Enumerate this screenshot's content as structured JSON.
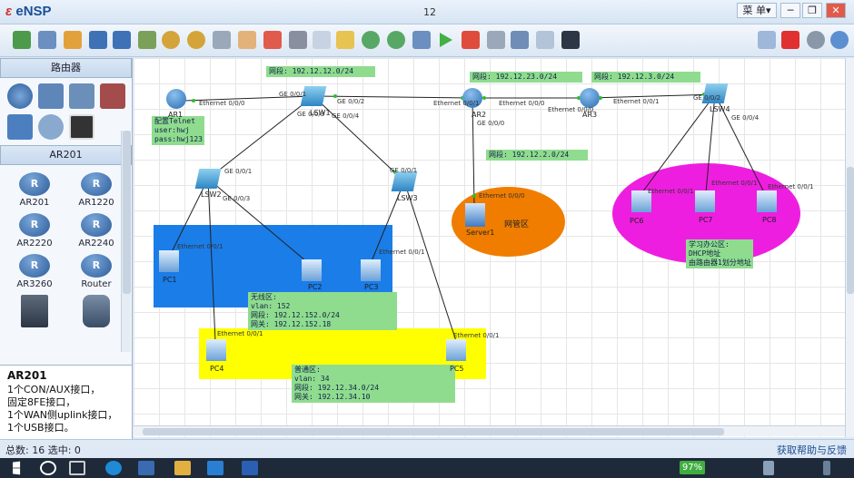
{
  "window": {
    "app_name": "eNSP",
    "title": "12",
    "menu_label": "菜 单▾",
    "min_label": "─",
    "max_label": "❐",
    "close_label": "✕"
  },
  "toolbar": {
    "buttons": [
      "new-topology-icon",
      "new-example-icon",
      "open-icon",
      "save-icon",
      "save-as-icon",
      "print-icon",
      "undo-icon",
      "redo-icon",
      "select-icon",
      "pan-hand-icon",
      "delete-icon",
      "delete-all-connections-icon",
      "text-icon",
      "palette-icon",
      "zoom-in-icon",
      "zoom-out-icon",
      "fit-view-icon",
      "start-icon",
      "stop-icon",
      "capture-icon",
      "topology-icon",
      "console-icon",
      "screenshot-icon"
    ],
    "right_buttons": [
      "chat-icon",
      "huawei-icon",
      "settings-icon",
      "help-icon"
    ]
  },
  "palette": {
    "section_routers": "路由器",
    "section_ar201": "AR201",
    "devices": [
      {
        "label": "AR201"
      },
      {
        "label": "AR1220"
      },
      {
        "label": "AR2220"
      },
      {
        "label": "AR2240"
      },
      {
        "label": "AR3260"
      },
      {
        "label": "Router"
      }
    ],
    "description_title": "AR201",
    "description_lines": [
      "1个CON/AUX接口，",
      "固定8FE接口，",
      "1个WAN侧uplink接口，",
      "1个USB接口。"
    ]
  },
  "canvas": {
    "notes": {
      "net_12_12": "网段: 192.12.12.0/24",
      "net_12_23": "网段: 192.12.23.0/24",
      "net_12_3": "网段: 192.12.3.0/24",
      "net_12_2": "网段: 192.12.2.0/24",
      "telnet": "配置Telnet\nuser:hwj\npass:hwj123",
      "wireless": "无线区:\nvlan: 152\n网段: 192.12.152.0/24\n网关: 192.12.152.18",
      "normal": "普通区:\nvlan: 34\n网段: 192.12.34.0/24\n网关: 192.12.34.10",
      "study": "学习办公区:\nDHCP地址\n由路由器1划分地址",
      "server_zone": "网管区"
    },
    "devices": {
      "ar1": "AR1",
      "lsw1": "LSW1",
      "ar2": "AR2",
      "ar3": "AR3",
      "lsw4": "LSW4",
      "lsw2": "LSW2",
      "lsw3": "LSW3",
      "server1": "Server1",
      "pc1": "PC1",
      "pc2": "PC2",
      "pc3": "PC3",
      "pc4": "PC4",
      "pc5": "PC5",
      "pc6": "PC6",
      "pc7": "PC7",
      "pc8": "PC8"
    },
    "ports": {
      "eth000": "Ethernet 0/0/0",
      "eth001": "Ethernet 0/0/1",
      "ge001": "GE 0/0/1",
      "ge002": "GE 0/0/2",
      "ge003": "GE 0/0/3",
      "ge004": "GE 0/0/4",
      "ge000": "GE 0/0/0"
    },
    "colors": {
      "blue_zone": "#1a7de8",
      "yellow_zone": "#ffff00",
      "orange_zone": "#f07d00",
      "magenta_zone": "#ee1ee0",
      "note_bg": "#8fdc8f"
    }
  },
  "status": {
    "left": "总数: 16  选中: 0",
    "right": "获取帮助与反馈"
  },
  "taskbar": {
    "battery": "97%"
  }
}
